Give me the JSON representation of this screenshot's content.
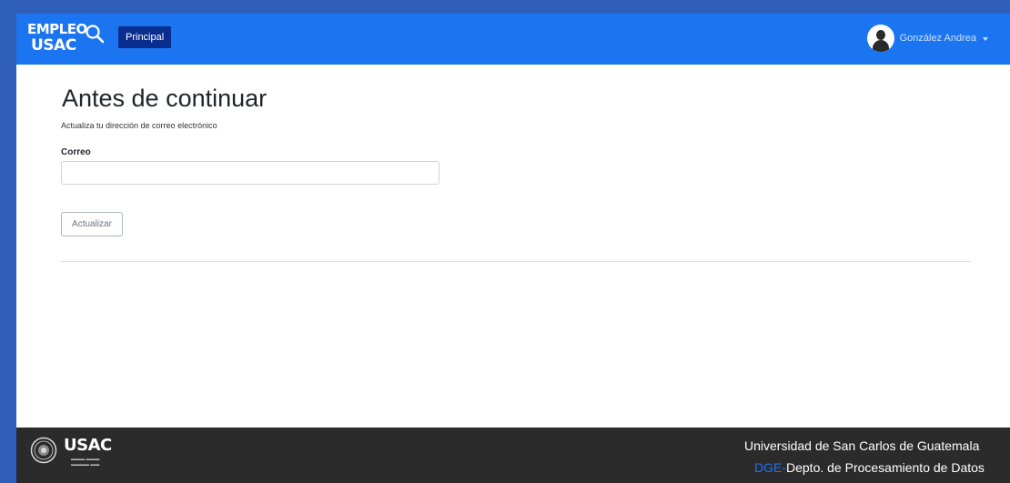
{
  "navbar": {
    "logo_line1": "EMPLEO",
    "logo_line2": "USAC",
    "principal_label": "Principal",
    "user_name": "González Andrea"
  },
  "main": {
    "title": "Antes de continuar",
    "subtitle": "Actualiza tu dirección de correo electrónico",
    "email_label": "Correo",
    "email_value": "",
    "email_placeholder": "",
    "update_button": "Actualizar"
  },
  "footer": {
    "brand": "USAC",
    "university": "Universidad de San Carlos de Guatemala",
    "dept_prefix": "DGE-",
    "dept_text": "Depto. de Procesamiento de Datos"
  },
  "colors": {
    "navbar": "#1b75f0",
    "principal_bg": "#0a2e8f",
    "footer_bg": "#2b2b2b",
    "accent": "#1b75f0"
  },
  "icons": [
    "magnifier-icon",
    "avatar-icon",
    "caret-down-icon",
    "usac-seal-icon"
  ]
}
